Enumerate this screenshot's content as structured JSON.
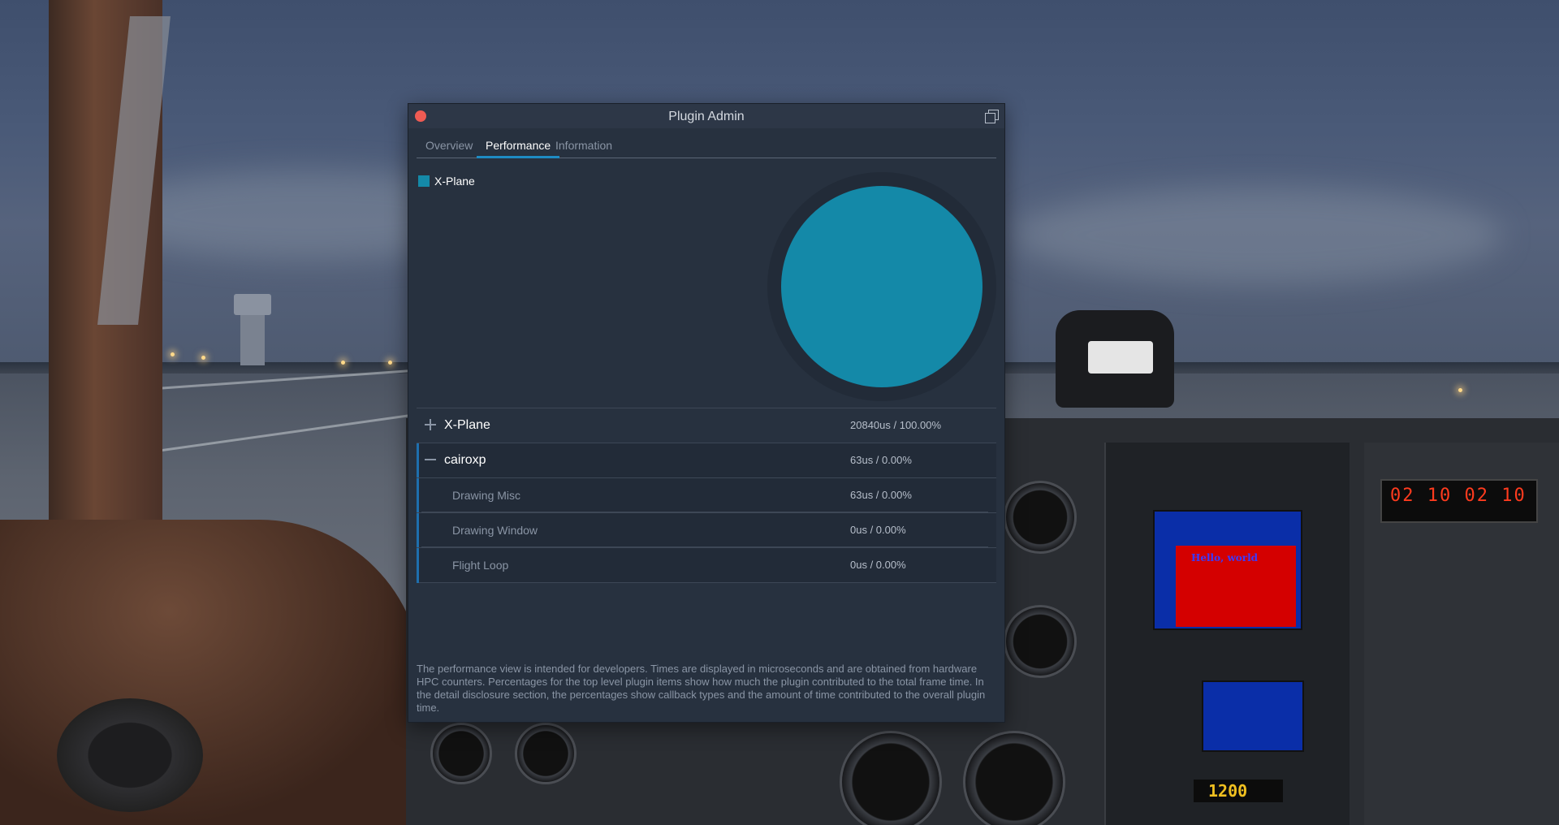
{
  "window": {
    "title": "Plugin Admin"
  },
  "tabs": [
    {
      "label": "Overview",
      "active": false
    },
    {
      "label": "Performance",
      "active": true
    },
    {
      "label": "Information",
      "active": false
    }
  ],
  "legend": {
    "items": [
      {
        "label": "X-Plane",
        "color": "#1489a8"
      }
    ]
  },
  "chart_data": {
    "type": "pie",
    "categories": [
      "X-Plane"
    ],
    "values": [
      100.0
    ],
    "colors": [
      "#1489a8"
    ]
  },
  "rows": [
    {
      "name": "X-Plane",
      "value": "20840us / 100.00%",
      "expanded": false
    },
    {
      "name": "cairoxp",
      "value": "63us / 0.00%",
      "expanded": true,
      "children": [
        {
          "name": "Drawing Misc",
          "value": "63us / 0.00%"
        },
        {
          "name": "Drawing Window",
          "value": "0us / 0.00%"
        },
        {
          "name": "Flight Loop",
          "value": "0us / 0.00%"
        }
      ]
    }
  ],
  "footnote": "The performance view is intended for developers. Times are displayed in microseconds and are obtained from hardware HPC counters. Percentages for the top level plugin items show how much the plugin contributed to the total frame time. In the detail disclosure section, the percentages show callback types and the amount of time contributed to the overall plugin time.",
  "background": {
    "gps_text": "Hello, world",
    "radio_text": "02 10   02 10",
    "transponder_code": "1200"
  }
}
